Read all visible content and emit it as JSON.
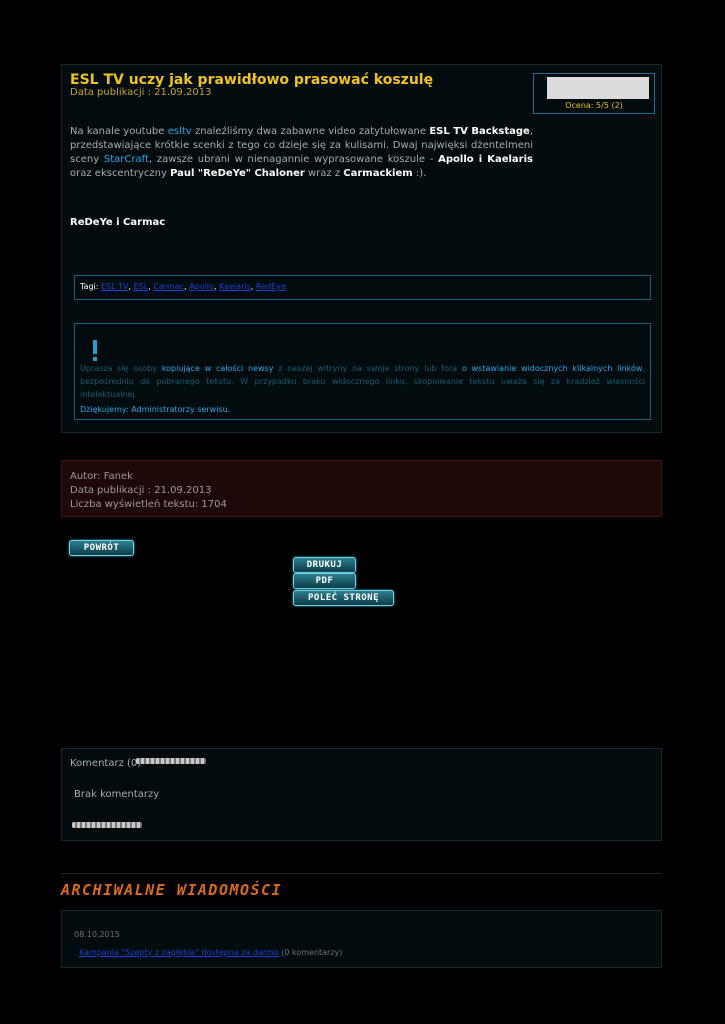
{
  "article": {
    "title": "ESL TV uczy jak prawidłowo prasować koszulę",
    "pubdate": "Data publikacji : 21.09.2013",
    "rating": "Ocena: 5/5 (2)",
    "intro": {
      "t1": "Na kanale youtube ",
      "l1": "esltv",
      "t2": " znaleźliśmy dwa zabawne video zatytułowane ",
      "b1": "ESL TV Backstage",
      "t3": ", przedstawiające krótkie scenki z tego co dzieje się za kulisami. Dwaj najwięksi dżentelmeni sceny ",
      "l2": "StarCraft",
      "t4": ", zawsze ubrani w nienagannie wyprasowane koszule - ",
      "b2": "Apollo i Kaelaris",
      "t5": " oraz ekscentryczny ",
      "b3": "Paul \"ReDeYe\" Chaloner",
      "t6": " wraz z ",
      "b4": "Carmackiem",
      "t7": " :)."
    },
    "subhead": "ReDeYe i Carmac",
    "tags_label": "Tagi:",
    "tags": [
      "ESL TV",
      "ESL",
      "Carmac",
      "Apollo",
      "Kaelaris",
      "RedEye"
    ],
    "notice": {
      "t1": "Uprasza się osoby ",
      "h1": "kopiujące w całości newsy",
      "t2": " z naszej witryny na swoje strony lub fora ",
      "h2": "o wstawianie widocznych klikalnych linków",
      "t3": ", bezpośrednio do pobranego tekstu. W przypadku braku widocznego linku, skopiowanie tekstu uważa się za kradzież własności intelektualnej.",
      "thanks": "Dziękujemy: Administratorzy serwisu."
    }
  },
  "meta": {
    "author": "Autor: Fanek",
    "pubdate": "Data publikacji : 21.09.2013",
    "views": "Liczba wyświetleń tekstu: 1704"
  },
  "buttons": {
    "back": "POWRÓT",
    "print": "DRUKUJ",
    "pdf": "PDF",
    "recommend": "POLEĆ STRONĘ"
  },
  "comments": {
    "count": "Komentarz (0)",
    "none": "Brak komentarzy"
  },
  "archive": {
    "title": "ARCHIWALNE WIADOMOŚCI",
    "date": "08.10.2015",
    "link": "Kampania \"Szepty z zagłębia\" dostępna za darmo",
    "comments": " (0 komentarzy)"
  }
}
